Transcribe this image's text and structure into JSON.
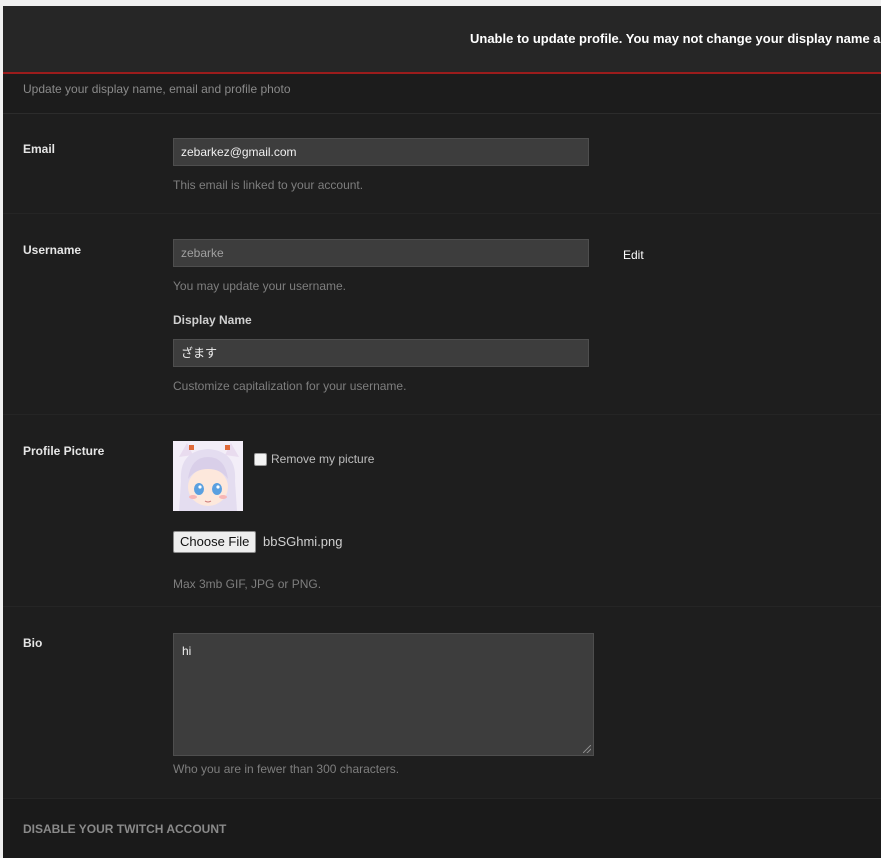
{
  "banner": {
    "message": "Unable to update profile. You may not change your display name a"
  },
  "header": {
    "subtitle": "Update your display name, email and profile photo"
  },
  "email": {
    "label": "Email",
    "value": "zebarkez@gmail.com",
    "help": "This email is linked to your account."
  },
  "username": {
    "label": "Username",
    "value": "zebarke",
    "edit_label": "Edit",
    "help": "You may update your username.",
    "display_name_label": "Display Name",
    "display_name_value": "ざます",
    "display_name_help": "Customize capitalization for your username."
  },
  "profile_picture": {
    "label": "Profile Picture",
    "remove_label": "Remove my picture",
    "choose_file_label": "Choose File",
    "file_name": "bbSGhmi.png",
    "help": "Max 3mb GIF, JPG or PNG."
  },
  "bio": {
    "label": "Bio",
    "value": "hi",
    "help": "Who you are in fewer than 300 characters."
  },
  "footer": {
    "disable_label": "DISABLE YOUR TWITCH ACCOUNT"
  },
  "colors": {
    "accent_line": "#9b1c1c",
    "background": "#1e1e1e",
    "input_bg": "#3d3d3d"
  }
}
